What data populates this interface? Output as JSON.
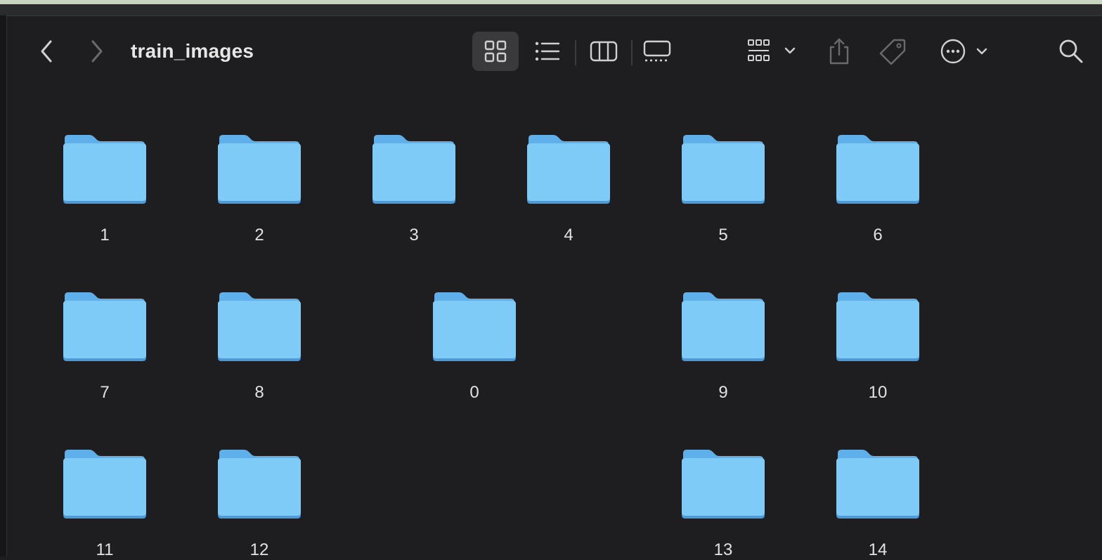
{
  "window": {
    "title": "train_images"
  },
  "toolbar": {
    "icons": [
      "back-icon",
      "forward-icon",
      "icon-view-icon",
      "list-view-icon",
      "column-view-icon",
      "gallery-view-icon",
      "group-icon",
      "share-icon",
      "tag-icon",
      "more-icon",
      "search-icon"
    ],
    "active_view": "icon-view"
  },
  "folders": [
    {
      "name": "1"
    },
    {
      "name": "2"
    },
    {
      "name": "3"
    },
    {
      "name": "4"
    },
    {
      "name": "5"
    },
    {
      "name": "6"
    },
    {
      "name": "7"
    },
    {
      "name": "8"
    },
    {
      "name": "0"
    },
    {
      "name": "9"
    },
    {
      "name": "10"
    },
    {
      "name": "11"
    },
    {
      "name": "12"
    },
    {
      "name": "13"
    },
    {
      "name": "14"
    }
  ],
  "colors": {
    "background": "#1e1e20",
    "folder_front": "#7ecbf8",
    "folder_back": "#5fb0ea",
    "folder_edge": "#4f9ad6",
    "icon": "#d0d0d0",
    "icon_dim": "#6a6a6e"
  }
}
